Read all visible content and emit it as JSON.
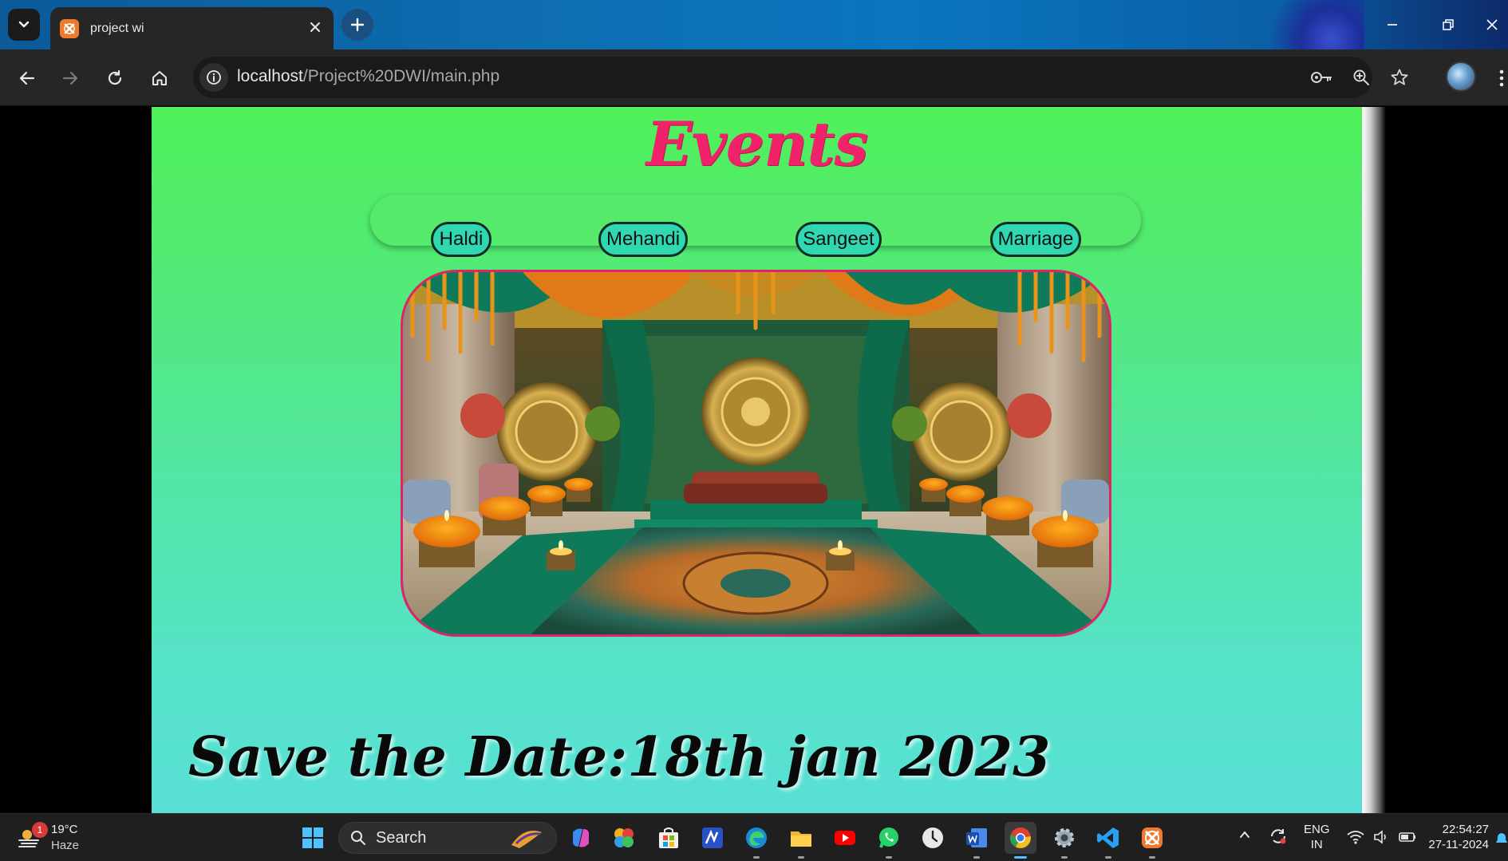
{
  "browser": {
    "tab_title": "project wi",
    "url_host": "localhost",
    "url_path": "/Project%20DWI/main.php"
  },
  "page": {
    "title": "Events",
    "nav": [
      "Haldi",
      "Mehandi",
      "Sangeet",
      "Marriage"
    ],
    "save_the_date": "Save the Date:18th jan 2023",
    "colors": {
      "title": "#f0226a",
      "pill": "#2fd8b0",
      "image_border": "#e0226a",
      "background_top": "#50f05a",
      "background_bottom": "#58e0d6"
    }
  },
  "taskbar": {
    "weather_badge": "1",
    "weather_temp": "19°C",
    "weather_desc": "Haze",
    "search_label": "Search",
    "apps": [
      "windows-start",
      "search",
      "copilot",
      "photos",
      "microsoft-store",
      "ai-app",
      "edge",
      "file-explorer",
      "youtube",
      "whatsapp",
      "clock",
      "word",
      "chrome",
      "settings",
      "vscode",
      "xampp"
    ],
    "lang_line1": "ENG",
    "lang_line2": "IN",
    "time": "22:54:27",
    "date": "27-11-2024"
  }
}
